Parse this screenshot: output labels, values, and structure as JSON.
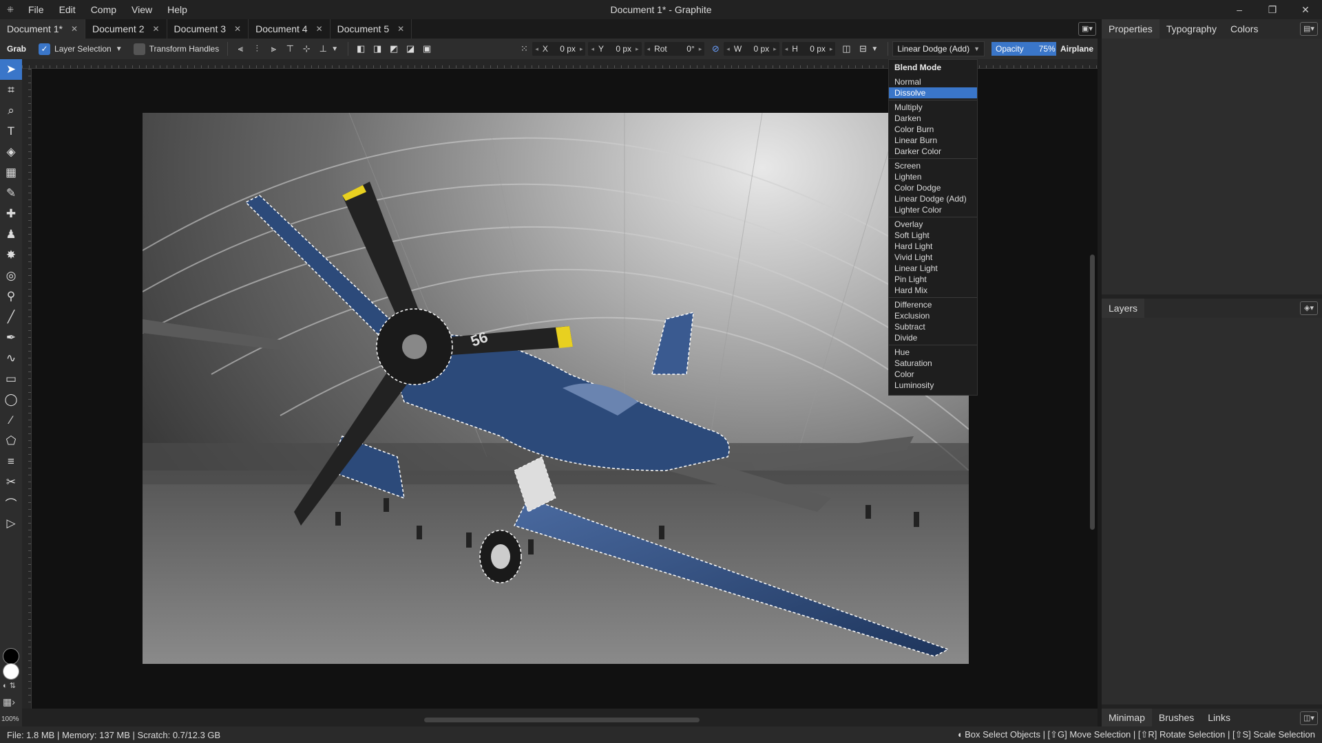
{
  "app": {
    "title": "Document 1* - Graphite",
    "logo": "⁜",
    "menus": [
      "File",
      "Edit",
      "Comp",
      "View",
      "Help"
    ],
    "window_controls": {
      "minimize": "–",
      "restore": "❐",
      "close": "✕"
    }
  },
  "tabs": [
    {
      "label": "Document 1*",
      "active": true
    },
    {
      "label": "Document 2",
      "active": false
    },
    {
      "label": "Document 3",
      "active": false
    },
    {
      "label": "Document 4",
      "active": false
    },
    {
      "label": "Document 5",
      "active": false
    }
  ],
  "tab_close": "✕",
  "options_bar": {
    "tool": "Grab",
    "layer_selection_label": "Layer Selection",
    "layer_selection_checked": true,
    "transform_handles_label": "Transform Handles",
    "transform_handles_checked": false,
    "x_label": "X",
    "x_value": "0 px",
    "y_label": "Y",
    "y_value": "0 px",
    "rot_label": "Rot",
    "rot_value": "0°",
    "w_label": "W",
    "w_value": "0 px",
    "h_label": "H",
    "h_value": "0 px",
    "blend_mode": "Linear Dodge (Add)",
    "opacity_label": "Opacity",
    "opacity_value": "75%",
    "layer_name": "Airplane"
  },
  "blend_menu": {
    "title": "Blend Mode",
    "selected": "Dissolve",
    "groups": [
      [
        "Normal",
        "Dissolve"
      ],
      [
        "Multiply",
        "Darken",
        "Color Burn",
        "Linear Burn",
        "Darker Color"
      ],
      [
        "Screen",
        "Lighten",
        "Color Dodge",
        "Linear Dodge (Add)",
        "Lighter Color"
      ],
      [
        "Overlay",
        "Soft Light",
        "Hard Light",
        "Vivid Light",
        "Linear Light",
        "Pin Light",
        "Hard Mix"
      ],
      [
        "Difference",
        "Exclusion",
        "Subtract",
        "Divide"
      ],
      [
        "Hue",
        "Saturation",
        "Color",
        "Luminosity"
      ]
    ]
  },
  "panels": {
    "properties_tabs": [
      "Properties",
      "Typography",
      "Colors"
    ],
    "layers_title": "Layers",
    "bottom_tabs": [
      "Minimap",
      "Brushes",
      "Links"
    ]
  },
  "zoom": "100%",
  "status": {
    "left": "File: 1.8 MB | Memory: 137 MB | Scratch: 0.7/12.3 GB",
    "right": "Box Select Objects | [⇧G] Move Selection | [⇧R] Rotate Selection | [⇧S] Scale Selection"
  },
  "image_labels": {
    "plane_number": "56"
  },
  "colors": {
    "accent": "#3a76c9",
    "plane_blue": "#2c4a7a",
    "prop_tip": "#e8d020"
  }
}
